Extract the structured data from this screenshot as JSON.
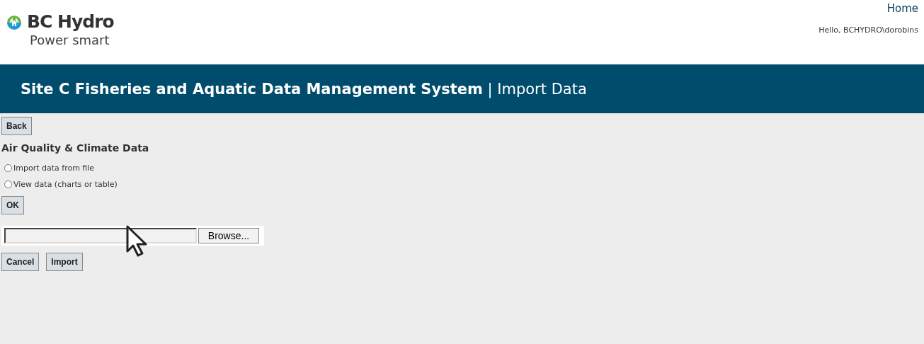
{
  "logo": {
    "brand": "BC Hydro",
    "tagline": "Power smart"
  },
  "nav": {
    "home_link": "Home",
    "greeting": "Hello, BCHYDRO\\dorobins"
  },
  "banner": {
    "title": "**Site C Fisheries and Aquatic Data Management System** | Import Data"
  },
  "back_button": "Back",
  "section_title": "Air Quality & Climate Data",
  "options": [
    {
      "label": "Import data from file",
      "selected": false
    },
    {
      "label": "View data (charts or table)",
      "selected": false
    }
  ],
  "ok_button": "OK",
  "file_picker": {
    "browse_button": "Browse..."
  },
  "actions": [
    "Cancel",
    "Import"
  ]
}
